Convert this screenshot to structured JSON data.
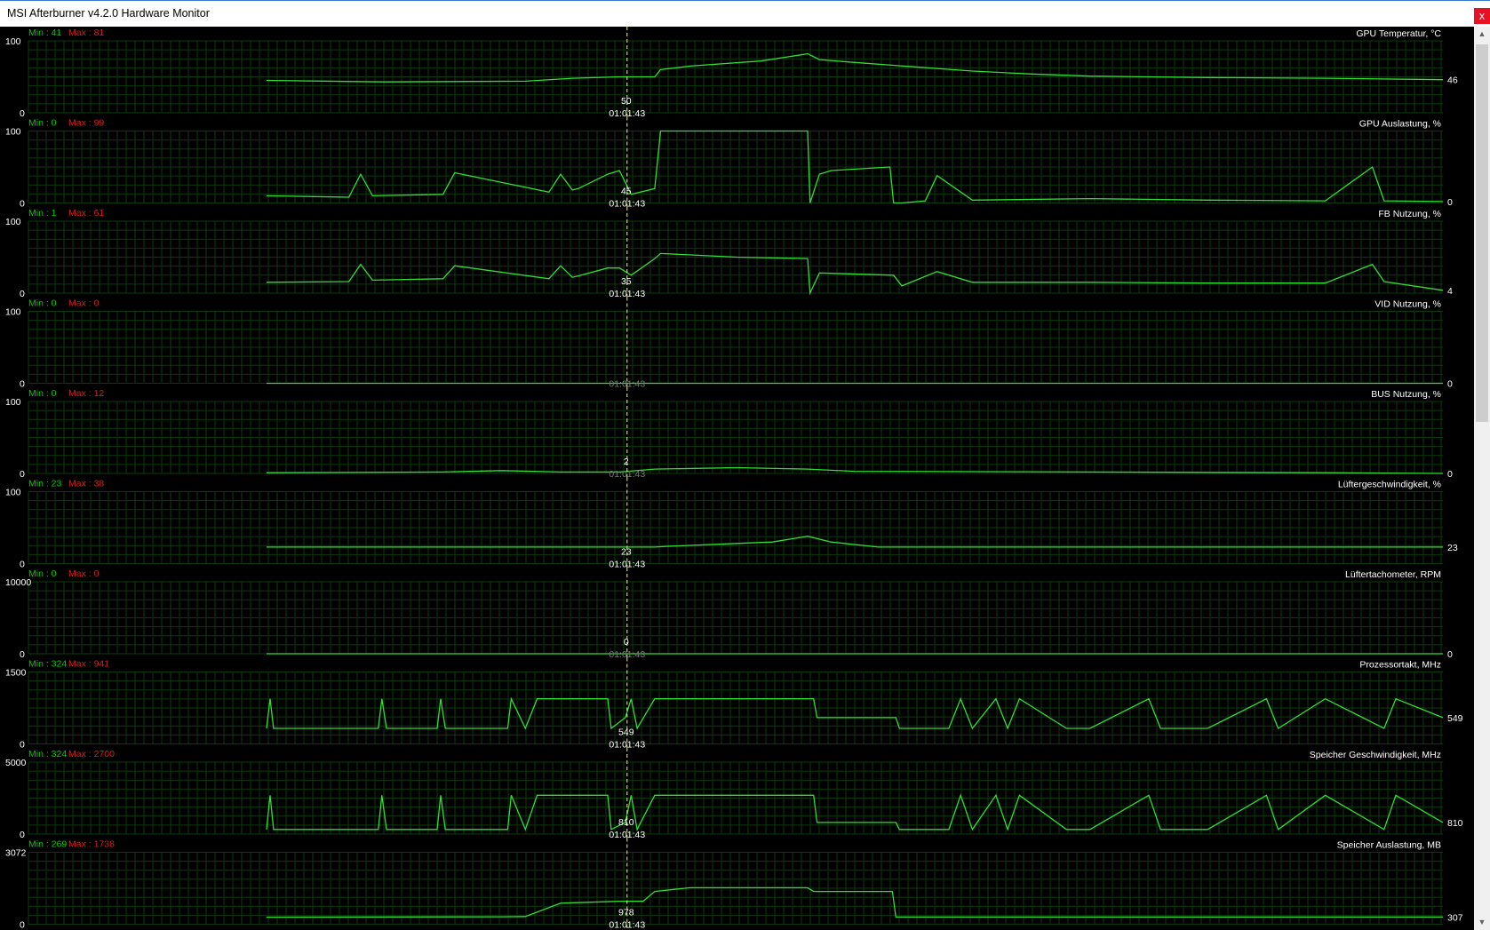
{
  "window": {
    "title": "MSI Afterburner v4.2.0 Hardware Monitor",
    "close_glyph": "x"
  },
  "cursor_time": "01:01:43",
  "min_prefix": "Min : ",
  "max_prefix": "Max : ",
  "colors": {
    "line": "#33dd33",
    "min": "#00cc00",
    "max": "#cc2222",
    "grid": "#0c3a0c",
    "cursor": "#ffff33",
    "background": "#000000"
  },
  "scrollbar": {
    "up_icon": "▲",
    "down_icon": "▼"
  },
  "panels": [
    {
      "name": "GPU Temperatur, °C",
      "min": "41",
      "max": "81",
      "ymax": "100",
      "ymin": "0",
      "ymax_value": 100,
      "current": "46",
      "cursor_value": "50",
      "cursor_time_dim": false
    },
    {
      "name": "GPU Auslastung, %",
      "min": "0",
      "max": "99",
      "ymax": "100",
      "ymin": "0",
      "ymax_value": 100,
      "current": "0",
      "cursor_value": "45",
      "cursor_time_dim": false
    },
    {
      "name": "FB Nutzung, %",
      "min": "1",
      "max": "61",
      "ymax": "100",
      "ymin": "0",
      "ymax_value": 100,
      "current": "4",
      "cursor_value": "35",
      "cursor_time_dim": false
    },
    {
      "name": "VID Nutzung, %",
      "min": "0",
      "max": "0",
      "ymax": "100",
      "ymin": "0",
      "ymax_value": 100,
      "current": "0",
      "cursor_value": "",
      "cursor_time_dim": true
    },
    {
      "name": "BUS Nutzung, %",
      "min": "0",
      "max": "12",
      "ymax": "100",
      "ymin": "0",
      "ymax_value": 100,
      "current": "0",
      "cursor_value": "2",
      "cursor_time_dim": true
    },
    {
      "name": "Lüftergeschwindigkeit, %",
      "min": "23",
      "max": "38",
      "ymax": "100",
      "ymin": "0",
      "ymax_value": 100,
      "current": "23",
      "cursor_value": "23",
      "cursor_time_dim": false
    },
    {
      "name": "Lüftertachometer, RPM",
      "min": "0",
      "max": "0",
      "ymax": "10000",
      "ymin": "0",
      "ymax_value": 10000,
      "current": "0",
      "cursor_value": "0",
      "cursor_time_dim": true
    },
    {
      "name": "Prozessortakt, MHz",
      "min": "324",
      "max": "941",
      "ymax": "1500",
      "ymin": "0",
      "ymax_value": 1500,
      "current": "549",
      "cursor_value": "549",
      "cursor_time_dim": false
    },
    {
      "name": "Speicher Geschwindigkeit, MHz",
      "min": "324",
      "max": "2700",
      "ymax": "5000",
      "ymin": "0",
      "ymax_value": 5000,
      "current": "810",
      "cursor_value": "810",
      "cursor_time_dim": false
    },
    {
      "name": "Speicher Auslastung, MB",
      "min": "269",
      "max": "1738",
      "ymax": "3072",
      "ymin": "0",
      "ymax_value": 3072,
      "current": "307",
      "cursor_value": "978",
      "cursor_time_dim": false
    }
  ],
  "chart_data": {
    "type": "line",
    "x_range_fraction": [
      0,
      1
    ],
    "cursor_x_fraction": 0.3065,
    "series": [
      {
        "name": "GPU Temperatur, °C",
        "ylim": [
          0,
          100
        ],
        "x": [
          0,
          0.1,
          0.22,
          0.26,
          0.3,
          0.33,
          0.335,
          0.36,
          0.42,
          0.46,
          0.47,
          0.5,
          0.55,
          0.6,
          0.65,
          0.7,
          0.8,
          0.9,
          1.0
        ],
        "values": [
          45,
          43,
          44,
          48,
          50,
          50,
          60,
          65,
          72,
          82,
          74,
          70,
          64,
          58,
          54,
          51,
          49,
          48,
          46
        ]
      },
      {
        "name": "GPU Auslastung, %",
        "ylim": [
          0,
          100
        ],
        "x": [
          0,
          0.07,
          0.08,
          0.09,
          0.15,
          0.16,
          0.24,
          0.25,
          0.26,
          0.265,
          0.29,
          0.3,
          0.31,
          0.33,
          0.335,
          0.335,
          0.46,
          0.462,
          0.47,
          0.48,
          0.53,
          0.533,
          0.54,
          0.56,
          0.57,
          0.6,
          0.7,
          0.8,
          0.9,
          0.94,
          0.95,
          1.0
        ],
        "values": [
          10,
          8,
          40,
          10,
          12,
          42,
          15,
          40,
          18,
          20,
          40,
          45,
          12,
          20,
          100,
          100,
          100,
          0,
          40,
          45,
          50,
          0,
          0,
          3,
          38,
          4,
          6,
          4,
          3,
          50,
          3,
          2
        ]
      },
      {
        "name": "FB Nutzung, %",
        "ylim": [
          0,
          100
        ],
        "x": [
          0,
          0.07,
          0.08,
          0.09,
          0.15,
          0.16,
          0.24,
          0.25,
          0.26,
          0.265,
          0.29,
          0.3,
          0.31,
          0.33,
          0.335,
          0.4,
          0.46,
          0.462,
          0.47,
          0.533,
          0.54,
          0.57,
          0.6,
          0.7,
          0.8,
          0.9,
          0.94,
          0.95,
          1.0
        ],
        "values": [
          15,
          16,
          40,
          18,
          20,
          38,
          20,
          38,
          22,
          24,
          35,
          35,
          25,
          48,
          55,
          50,
          48,
          0,
          28,
          25,
          10,
          30,
          15,
          15,
          14,
          14,
          40,
          16,
          4
        ]
      },
      {
        "name": "VID Nutzung, %",
        "ylim": [
          0,
          100
        ],
        "x": [
          0,
          1
        ],
        "values": [
          0,
          0
        ]
      },
      {
        "name": "BUS Nutzung, %",
        "ylim": [
          0,
          100
        ],
        "x": [
          0,
          0.15,
          0.2,
          0.25,
          0.3,
          0.33,
          0.4,
          0.46,
          0.5,
          0.7,
          0.9,
          1.0
        ],
        "values": [
          1,
          2,
          4,
          2,
          2,
          6,
          8,
          6,
          3,
          2,
          1,
          0
        ]
      },
      {
        "name": "Lüftergeschwindigkeit, %",
        "ylim": [
          0,
          100
        ],
        "x": [
          0,
          0.33,
          0.34,
          0.4,
          0.43,
          0.46,
          0.48,
          0.52,
          1.0
        ],
        "values": [
          23,
          23,
          24,
          28,
          30,
          38,
          30,
          23,
          23
        ]
      },
      {
        "name": "Lüftertachometer, RPM",
        "ylim": [
          0,
          10000
        ],
        "x": [
          0,
          1
        ],
        "values": [
          0,
          0
        ]
      },
      {
        "name": "Prozessortakt, MHz",
        "ylim": [
          0,
          1500
        ],
        "x": [
          0,
          0.003,
          0.006,
          0.095,
          0.098,
          0.102,
          0.145,
          0.148,
          0.152,
          0.205,
          0.208,
          0.22,
          0.23,
          0.232,
          0.26,
          0.263,
          0.29,
          0.293,
          0.305,
          0.31,
          0.315,
          0.33,
          0.335,
          0.465,
          0.468,
          0.535,
          0.538,
          0.58,
          0.59,
          0.6,
          0.62,
          0.63,
          0.64,
          0.68,
          0.7,
          0.75,
          0.76,
          0.8,
          0.85,
          0.86,
          0.9,
          0.95,
          0.96,
          1.0
        ],
        "values": [
          324,
          941,
          324,
          324,
          941,
          324,
          324,
          941,
          324,
          324,
          941,
          324,
          941,
          941,
          941,
          941,
          941,
          324,
          549,
          941,
          324,
          941,
          941,
          941,
          549,
          549,
          324,
          324,
          941,
          324,
          941,
          324,
          941,
          324,
          324,
          941,
          324,
          324,
          941,
          324,
          941,
          324,
          941,
          549
        ]
      },
      {
        "name": "Speicher Geschwindigkeit, MHz",
        "ylim": [
          0,
          5000
        ],
        "x": [
          0,
          0.003,
          0.006,
          0.095,
          0.098,
          0.102,
          0.145,
          0.148,
          0.152,
          0.205,
          0.208,
          0.22,
          0.23,
          0.232,
          0.26,
          0.263,
          0.29,
          0.293,
          0.305,
          0.31,
          0.315,
          0.33,
          0.335,
          0.465,
          0.468,
          0.535,
          0.538,
          0.58,
          0.59,
          0.6,
          0.62,
          0.63,
          0.64,
          0.68,
          0.7,
          0.75,
          0.76,
          0.8,
          0.85,
          0.86,
          0.9,
          0.95,
          0.96,
          1.0
        ],
        "values": [
          324,
          2700,
          324,
          324,
          2700,
          324,
          324,
          2700,
          324,
          324,
          2700,
          324,
          2700,
          2700,
          2700,
          2700,
          2700,
          324,
          810,
          2700,
          324,
          2700,
          2700,
          2700,
          810,
          810,
          324,
          324,
          2700,
          324,
          2700,
          324,
          2700,
          324,
          324,
          2700,
          324,
          324,
          2700,
          324,
          2700,
          324,
          2700,
          810
        ]
      },
      {
        "name": "Speicher Auslastung, MB",
        "ylim": [
          0,
          3072
        ],
        "x": [
          0,
          0.2,
          0.22,
          0.25,
          0.3,
          0.32,
          0.33,
          0.36,
          0.46,
          0.465,
          0.532,
          0.535,
          1.0
        ],
        "values": [
          300,
          320,
          330,
          900,
          978,
          978,
          1400,
          1560,
          1560,
          1400,
          1400,
          307,
          307
        ]
      }
    ]
  }
}
